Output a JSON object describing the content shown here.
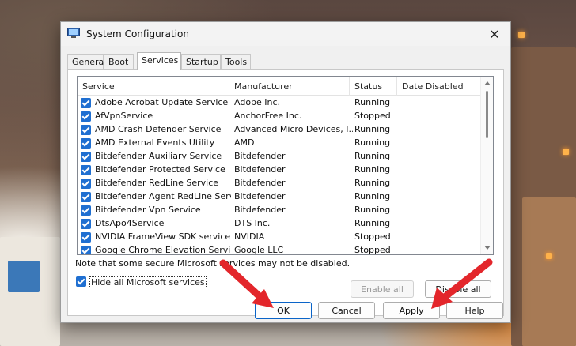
{
  "window": {
    "title": "System Configuration",
    "close_glyph": "✕"
  },
  "tabs": [
    {
      "label": "General",
      "active": false
    },
    {
      "label": "Boot",
      "active": false
    },
    {
      "label": "Services",
      "active": true
    },
    {
      "label": "Startup",
      "active": false
    },
    {
      "label": "Tools",
      "active": false
    }
  ],
  "services_table": {
    "columns": [
      "Service",
      "Manufacturer",
      "Status",
      "Date Disabled"
    ],
    "rows": [
      {
        "name": "Adobe Acrobat Update Service",
        "manufacturer": "Adobe Inc.",
        "status": "Running",
        "checked": true
      },
      {
        "name": "AfVpnService",
        "manufacturer": "AnchorFree Inc.",
        "status": "Stopped",
        "checked": true
      },
      {
        "name": "AMD Crash Defender Service",
        "manufacturer": "Advanced Micro Devices, I...",
        "status": "Running",
        "checked": true
      },
      {
        "name": "AMD External Events Utility",
        "manufacturer": "AMD",
        "status": "Running",
        "checked": true
      },
      {
        "name": "Bitdefender Auxiliary Service",
        "manufacturer": "Bitdefender",
        "status": "Running",
        "checked": true
      },
      {
        "name": "Bitdefender Protected Service",
        "manufacturer": "Bitdefender",
        "status": "Running",
        "checked": true
      },
      {
        "name": "Bitdefender RedLine Service",
        "manufacturer": "Bitdefender",
        "status": "Running",
        "checked": true
      },
      {
        "name": "Bitdefender Agent RedLine Service",
        "manufacturer": "Bitdefender",
        "status": "Running",
        "checked": true
      },
      {
        "name": "Bitdefender Vpn Service",
        "manufacturer": "Bitdefender",
        "status": "Running",
        "checked": true
      },
      {
        "name": "DtsApo4Service",
        "manufacturer": "DTS Inc.",
        "status": "Running",
        "checked": true
      },
      {
        "name": "NVIDIA FrameView SDK service",
        "manufacturer": "NVIDIA",
        "status": "Stopped",
        "checked": true
      },
      {
        "name": "Google Chrome Elevation Servic...",
        "manufacturer": "Google LLC",
        "status": "Stopped",
        "checked": true
      }
    ]
  },
  "note": "Note that some secure Microsoft services may not be disabled.",
  "buttons": {
    "enable_all": "Enable all",
    "disable_all": "Disable all",
    "ok": "OK",
    "cancel": "Cancel",
    "apply": "Apply",
    "help": "Help"
  },
  "hide_ms": {
    "label": "Hide all Microsoft services",
    "checked": true
  },
  "colors": {
    "accent": "#1f6fd1",
    "arrow": "#e3262b",
    "ok_border": "#0a64c8"
  }
}
